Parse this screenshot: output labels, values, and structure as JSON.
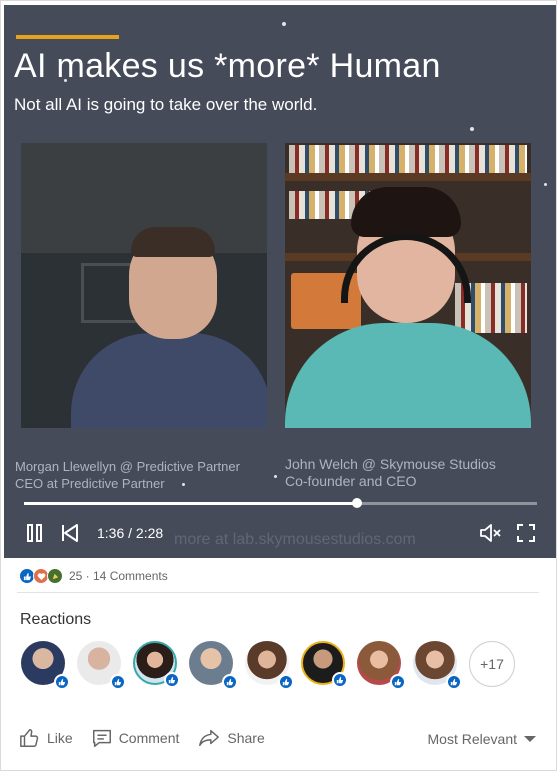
{
  "video": {
    "title": "AI makes us *more* Human",
    "subtitle": "Not all AI is going to take over the world.",
    "speaker_left": {
      "line1": "Morgan Llewellyn @ Predictive Partner",
      "line2": "CEO at Predictive Partner"
    },
    "speaker_right": {
      "line1": "John Welch @ Skymouse Studios",
      "line2": "Co-founder and CEO"
    },
    "watermark": "more at lab.skymousestudios.com",
    "time_display": "1:36 / 2:28",
    "progress_fraction": 0.65,
    "accent_color": "#e9a21b",
    "controls": {
      "play_state_icon": "pause-icon",
      "back_icon": "skip-back-icon",
      "volume_icon": "mute-icon",
      "fullscreen_icon": "fullscreen-icon"
    }
  },
  "social": {
    "reaction_icons": [
      "like-icon",
      "love-icon",
      "celebrate-icon"
    ],
    "counts_text": "25 · 14 Comments"
  },
  "reactions": {
    "title": "Reactions",
    "avatar_count_shown": 8,
    "more_label": "+17"
  },
  "actions": {
    "like": "Like",
    "comment": "Comment",
    "share": "Share",
    "sort_label": "Most Relevant"
  },
  "colors": {
    "brand_blue": "#0a66c2",
    "love_red": "#df704d",
    "celebrate_green": "#44712e"
  }
}
